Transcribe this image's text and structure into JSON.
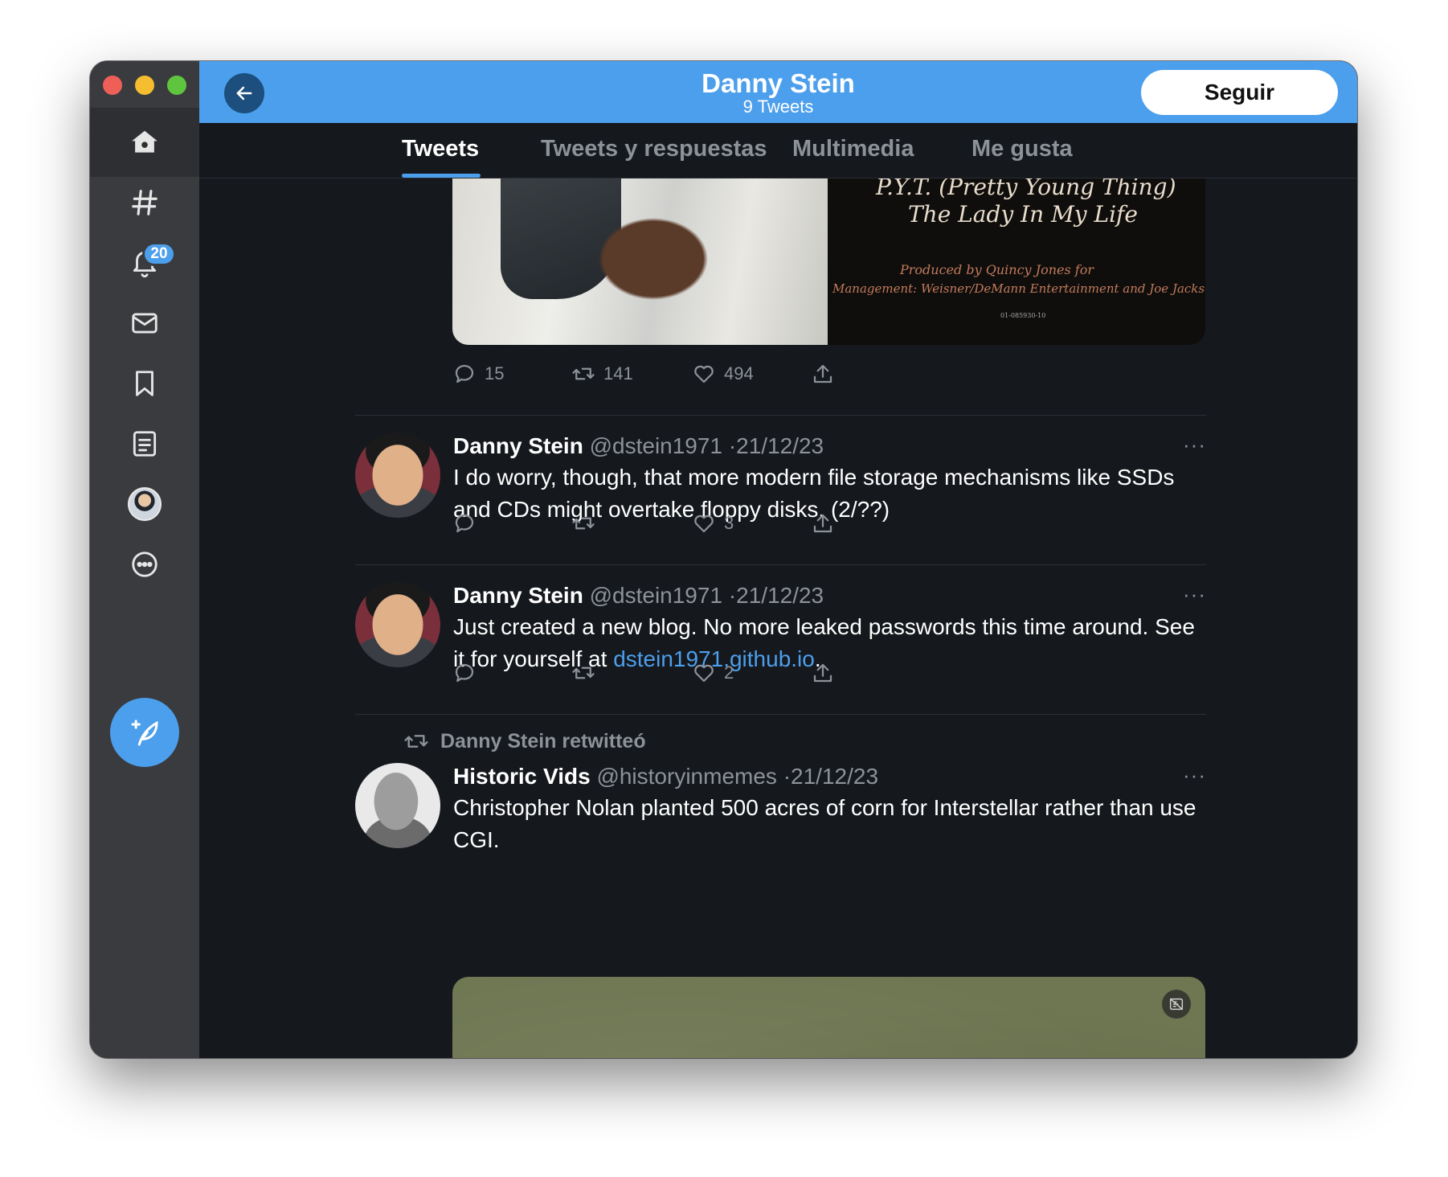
{
  "header": {
    "title": "Danny Stein",
    "subtitle": "9 Tweets",
    "follow_label": "Seguir"
  },
  "sidebar": {
    "notifications_badge": "20",
    "items": [
      {
        "icon": "home-icon"
      },
      {
        "icon": "hashtag-icon"
      },
      {
        "icon": "bell-icon"
      },
      {
        "icon": "mail-icon"
      },
      {
        "icon": "bookmark-icon"
      },
      {
        "icon": "list-icon"
      },
      {
        "icon": "avatar"
      },
      {
        "icon": "more-icon"
      },
      {
        "icon": "compose-icon"
      }
    ]
  },
  "tabs": [
    {
      "label": "Tweets",
      "active": true
    },
    {
      "label": "Tweets y respuestas",
      "active": false
    },
    {
      "label": "Multimedia",
      "active": false
    },
    {
      "label": "Me gusta",
      "active": false
    }
  ],
  "top_tweet": {
    "album_text": [
      "P.Y.T. (Pretty Young Thing)",
      "The Lady In My Life",
      "Produced by Quincy Jones for",
      "Management: Weisner/DeMann Entertainment and Joe Jackson",
      "01-085930-10"
    ],
    "replies": "15",
    "retweets": "141",
    "likes": "494"
  },
  "tweets": [
    {
      "name": "Danny Stein",
      "handle": "@dstein1971",
      "date": "21/12/23",
      "text": "I do worry, though, that more modern file storage mechanisms like SSDs and CDs might overtake floppy disks. (2/??)",
      "replies": "",
      "retweets": "",
      "likes": "3"
    },
    {
      "name": "Danny Stein",
      "handle": "@dstein1971",
      "date": "21/12/23",
      "text_before": "Just created a new blog. No more leaked passwords this time around. See it for yourself at ",
      "link": "dstein1971.github.io",
      "text_after": ".",
      "replies": "",
      "retweets": "",
      "likes": "2"
    },
    {
      "retweeted_by": "Danny Stein retwitteó",
      "name": "Historic Vids",
      "handle": "@historyinmemes",
      "date": "21/12/23",
      "text": "Christopher Nolan planted 500 acres of corn for Interstellar rather than use CGI."
    }
  ],
  "colors": {
    "accent": "#4c9fec",
    "background": "#15181d",
    "sidebar": "#3a3b3f",
    "muted_text": "#8d9299"
  }
}
